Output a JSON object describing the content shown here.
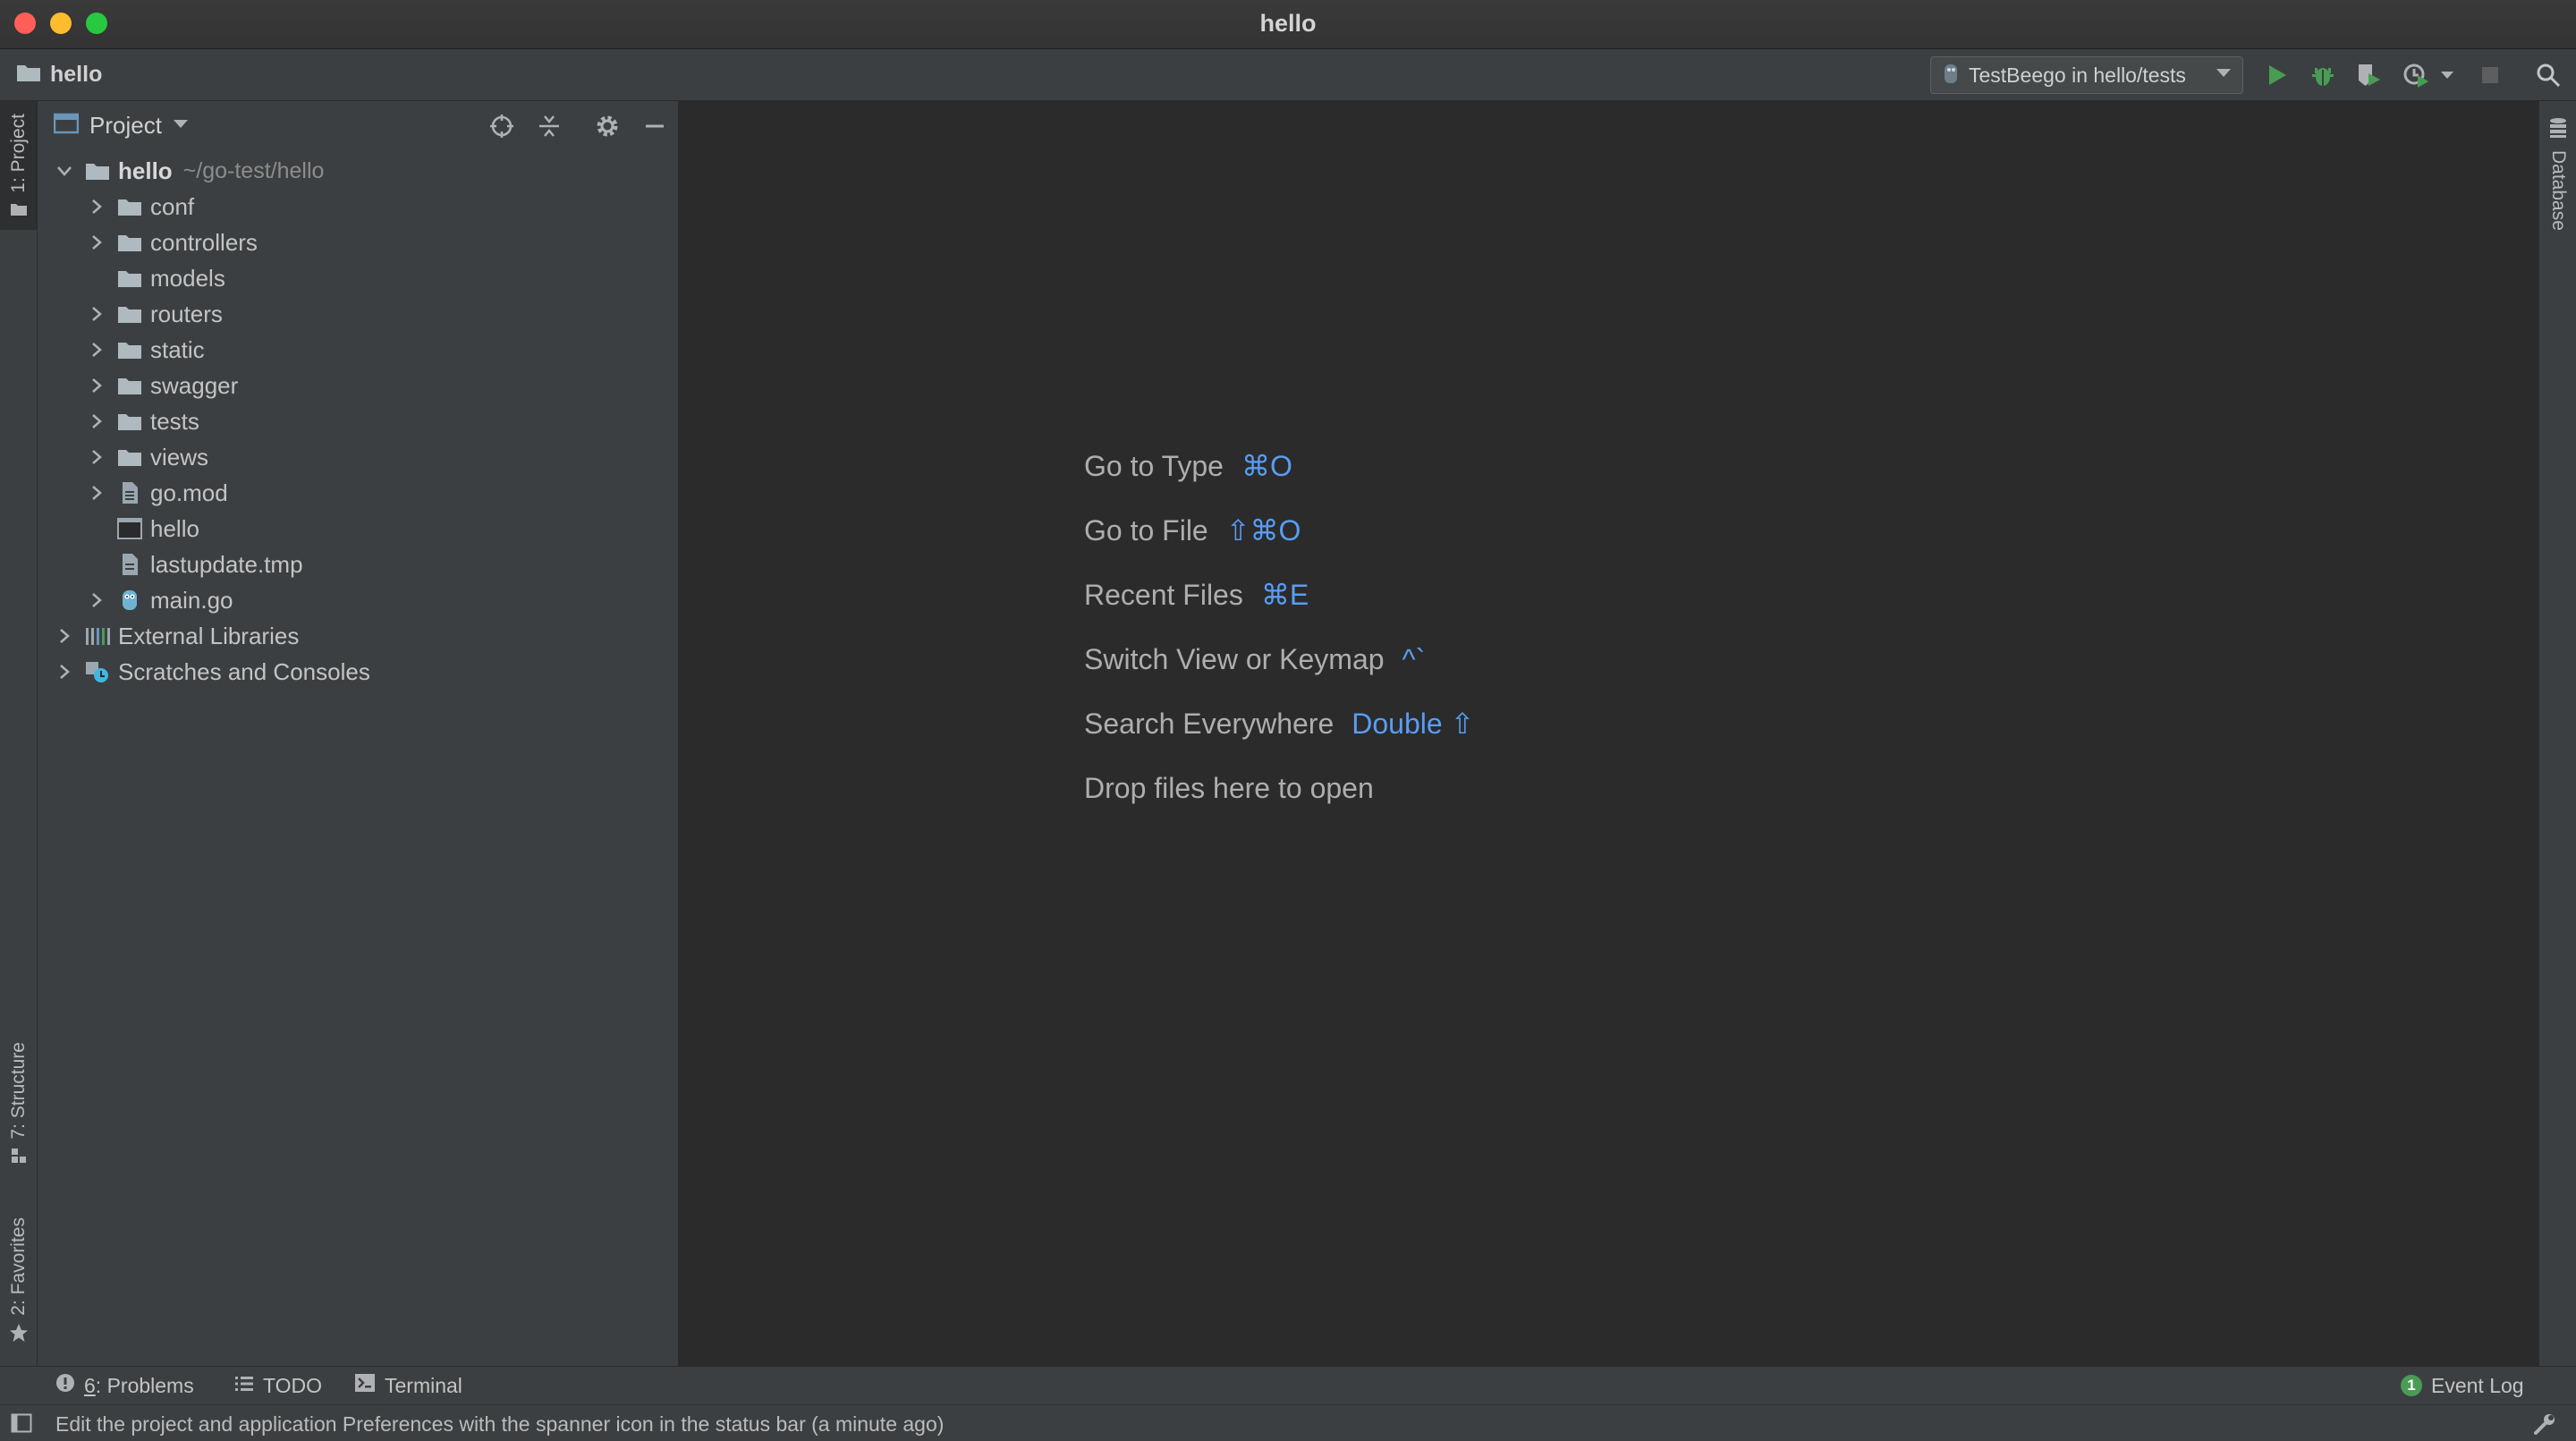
{
  "window": {
    "title": "hello"
  },
  "nav": {
    "breadcrumb": "hello",
    "run_config": "TestBeego in hello/tests"
  },
  "left_stripe": {
    "project_tab": "1: Project",
    "structure_tab": "7: Structure",
    "favorites_tab": "2: Favorites"
  },
  "right_stripe": {
    "database_tab": "Database"
  },
  "project_panel": {
    "title": "Project",
    "tree": [
      {
        "label": "hello",
        "path": "~/go-test/hello",
        "type": "folder",
        "expanded": true,
        "depth": 0
      },
      {
        "label": "conf",
        "type": "folder",
        "depth": 1
      },
      {
        "label": "controllers",
        "type": "folder",
        "depth": 1
      },
      {
        "label": "models",
        "type": "folder",
        "depth": 1
      },
      {
        "label": "routers",
        "type": "folder",
        "depth": 1
      },
      {
        "label": "static",
        "type": "folder",
        "depth": 1
      },
      {
        "label": "swagger",
        "type": "folder",
        "depth": 1
      },
      {
        "label": "tests",
        "type": "folder",
        "depth": 1
      },
      {
        "label": "views",
        "type": "folder",
        "depth": 1
      },
      {
        "label": "go.mod",
        "type": "gomod-file",
        "depth": 1
      },
      {
        "label": "hello",
        "type": "executable-file",
        "depth": 1
      },
      {
        "label": "lastupdate.tmp",
        "type": "text-file",
        "depth": 1
      },
      {
        "label": "main.go",
        "type": "go-file",
        "depth": 1
      },
      {
        "label": "External Libraries",
        "type": "libraries",
        "depth": 0
      },
      {
        "label": "Scratches and Consoles",
        "type": "scratches",
        "depth": 0
      }
    ]
  },
  "editor_hints": [
    {
      "text": "Go to Type",
      "shortcut": "⌘O"
    },
    {
      "text": "Go to File",
      "shortcut": "⇧⌘O"
    },
    {
      "text": "Recent Files",
      "shortcut": "⌘E"
    },
    {
      "text": "Switch View or Keymap",
      "shortcut": "^`"
    },
    {
      "text": "Search Everywhere",
      "shortcut": "Double ⇧"
    },
    {
      "text": "Drop files here to open",
      "shortcut": ""
    }
  ],
  "bottom_bar": {
    "problems_prefix": "6",
    "problems_label": ": Problems",
    "todo": "TODO",
    "terminal": "Terminal",
    "event_log_count": "1",
    "event_log": "Event Log"
  },
  "status": {
    "message": "Edit the project and application Preferences with the spanner icon in the status bar (a minute ago)"
  },
  "colors": {
    "accent_blue": "#589df6",
    "run_green": "#499c54",
    "panel_bg": "#3c3f41",
    "editor_bg": "#2b2b2b"
  }
}
